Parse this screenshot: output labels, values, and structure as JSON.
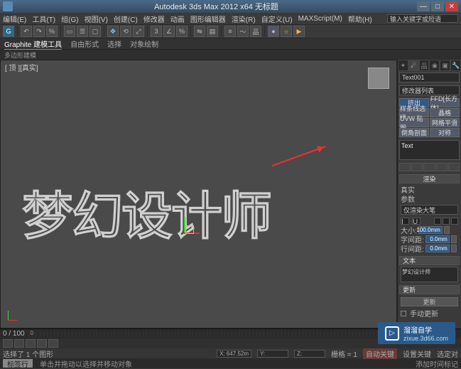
{
  "app": {
    "title": "Autodesk 3ds Max 2012 x64   无标题"
  },
  "winbtns": {
    "min": "—",
    "max": "□",
    "close": "✕"
  },
  "menu": {
    "items": [
      "编辑(E)",
      "工具(T)",
      "组(G)",
      "视图(V)",
      "创建(C)",
      "修改器",
      "动画",
      "图形编辑器",
      "渲染(R)",
      "自定义(U)",
      "MAXScript(M)",
      "帮助(H)"
    ],
    "search_placeholder": "输入关键字或短语"
  },
  "ribbon": {
    "tabs": [
      "Graphite 建模工具",
      "自由形式",
      "选择",
      "对象绘制"
    ],
    "sub": "多边形建模"
  },
  "viewport": {
    "label": "[ 顶 ][真实]",
    "text": "梦幻设计师"
  },
  "cmd": {
    "objname": "Text001",
    "modlist_label": "修改器列表",
    "highlight": "挤出",
    "grid": [
      [
        "挤出",
        "FFD[长方体]"
      ],
      [
        "样条线选择",
        "晶格"
      ],
      [
        "UVW 贴图",
        "网格平滑"
      ],
      [
        "倒角剖面",
        "对称"
      ]
    ],
    "stack_item": "Text",
    "rollouts": {
      "render": {
        "title": "渲染",
        "items": [
          "真实",
          "参数"
        ],
        "dropdown": "仅渲染大笔"
      },
      "params": {
        "title": "参数",
        "size_label": "大小:",
        "size": "100.0mm",
        "kerning_label": "字间距:",
        "kerning": "0.0mm",
        "leading_label": "行间距:",
        "leading": "0.0mm"
      },
      "text": {
        "title": "文本",
        "content": "梦幻设计师"
      },
      "update": {
        "title": "更新",
        "btn": "更新",
        "manual": "手动更新"
      }
    }
  },
  "track": {
    "range": "0 / 100",
    "frame0": "0"
  },
  "status": {
    "selected": "选择了 1 个图形",
    "hint": "单击并拖动以选择并移动对象",
    "x": "X: 647.52m",
    "y": "Y:",
    "z": "Z:",
    "grid": "栅格 = 1",
    "autokey": "自动关键",
    "setkey": "设置关键",
    "selfilter": "选定对"
  },
  "bottom": {
    "tab": "标签行",
    "add": "添加时间标记"
  },
  "watermark": {
    "name": "溜溜自学",
    "url": "zixue.3d66.com"
  }
}
